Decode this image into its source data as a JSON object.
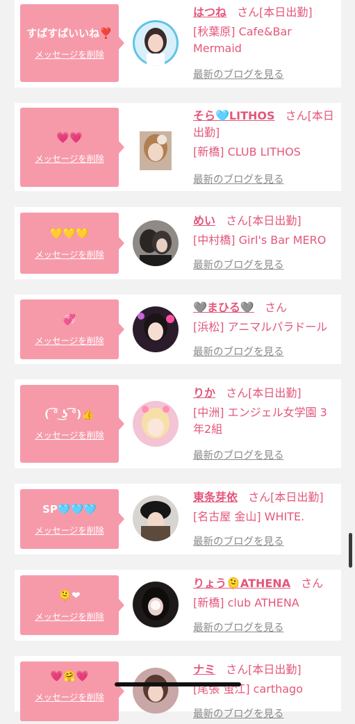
{
  "cards": [
    {
      "message": "すぱすぱいいね❣️",
      "delete": "メッセージを削除",
      "name": "はつね",
      "suffix": "さん",
      "status": "[本日出勤]",
      "shop": "[秋葉原] Cafe&Bar Mermaid",
      "blog": "最新のブログを見る"
    },
    {
      "message": "💗💗",
      "delete": "メッセージを削除",
      "name": "そら🩵LITHOS",
      "suffix": "さん",
      "status": "[本日出勤]",
      "shop": "[新橋] CLUB LITHOS",
      "blog": "最新のブログを見る"
    },
    {
      "message": "💛💛💛",
      "delete": "メッセージを削除",
      "name": "めい",
      "suffix": "さん",
      "status": "[本日出勤]",
      "shop": "[中村橋] Girl's Bar MERO",
      "blog": "最新のブログを見る"
    },
    {
      "message": "💞",
      "delete": "メッセージを削除",
      "name": "🩶まひる🩶",
      "suffix": "さん",
      "status": "",
      "shop": "[浜松] アニマルパラドール",
      "blog": "最新のブログを見る"
    },
    {
      "message": "( ͡° ͜ʖ ͡°)👍",
      "delete": "メッセージを削除",
      "name": "りか",
      "suffix": "さん",
      "status": "[本日出勤]",
      "shop": "[中洲] エンジェル女学園 3年2組",
      "blog": "最新のブログを見る"
    },
    {
      "message": "SP🩵🩵🩵",
      "delete": "メッセージを削除",
      "name": "東条芽依",
      "suffix": "さん",
      "status": "[本日出勤]",
      "shop": "[名古屋 金山] WHITE.",
      "blog": "最新のブログを見る"
    },
    {
      "message": "🫠❤",
      "delete": "メッセージを削除",
      "name": "りょう🫠ATHENA",
      "suffix": "さん",
      "status": "",
      "shop": "[新橋] club ATHENA",
      "blog": "最新のブログを見る"
    },
    {
      "message": "💗🤗💗",
      "delete": "メッセージを削除",
      "name": "ナミ",
      "suffix": "さん",
      "status": "[本日出勤]",
      "shop": "[尾張 蛍江] carthago",
      "blog": "最新のブログを見る"
    }
  ],
  "colors": {
    "accent": "#e4567a",
    "bubble": "#f69aaa",
    "muted": "#8a8a8a"
  }
}
